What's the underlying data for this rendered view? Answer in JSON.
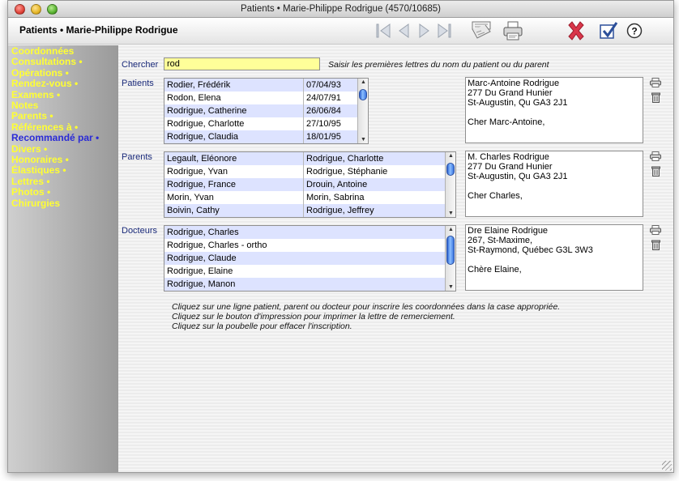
{
  "window": {
    "title": "Patients • Marie-Philippe Rodrigue (4570/10685)"
  },
  "header": {
    "title": "Patients • Marie-Philippe Rodrigue"
  },
  "toolbar": {
    "icons": [
      "first-record-icon",
      "previous-record-icon",
      "next-record-icon",
      "last-record-icon",
      "envelope-icon",
      "print-icon",
      "delete-icon",
      "validate-icon",
      "help-icon"
    ],
    "help_label": "?"
  },
  "sidebar": {
    "items": [
      {
        "label": "Coordonnées"
      },
      {
        "label": "Consultations •"
      },
      {
        "label": "Opérations •"
      },
      {
        "label": "Rendez-vous •"
      },
      {
        "label": "Examens •"
      },
      {
        "label": "Notes"
      },
      {
        "label": "Parents •"
      },
      {
        "label": "Références à •"
      },
      {
        "label": "Recommandé par •"
      },
      {
        "label": "Divers •"
      },
      {
        "label": "Honoraires •"
      },
      {
        "label": "Élastiques •"
      },
      {
        "label": "Lettres •"
      },
      {
        "label": "Photos •"
      },
      {
        "label": "Chirurgies"
      }
    ],
    "active_index": 8
  },
  "search": {
    "label": "Chercher",
    "value": "rod",
    "hint": "Saisir les premières lettres du nom du patient ou du parent"
  },
  "patients": {
    "label": "Patients",
    "rows": [
      [
        "Rodier, Frédérik",
        "07/04/93"
      ],
      [
        "Rodon, Elena",
        "24/07/91"
      ],
      [
        "Rodrigue, Catherine",
        "26/06/84"
      ],
      [
        "Rodrigue, Charlotte",
        "27/10/95"
      ],
      [
        "Rodrigue, Claudia",
        "18/01/95"
      ]
    ],
    "letter": [
      "Marc-Antoine Rodrigue",
      "277 Du Grand Hunier",
      "St-Augustin, Qu  GA3 2J1",
      "",
      "Cher Marc-Antoine,"
    ]
  },
  "parents": {
    "label": "Parents",
    "rows": [
      [
        "Legault, Eléonore",
        "Rodrigue, Charlotte"
      ],
      [
        "Rodrigue, Yvan",
        "Rodrigue, Stéphanie"
      ],
      [
        "Rodrigue, France",
        "Drouin, Antoine"
      ],
      [
        "Morin, Yvan",
        "Morin, Sabrina"
      ],
      [
        "Boivin, Cathy",
        "Rodrigue, Jeffrey"
      ]
    ],
    "letter": [
      "M. Charles Rodrigue",
      "277 Du Grand Hunier",
      "St-Augustin, Qu  GA3 2J1",
      "",
      "Cher Charles,"
    ]
  },
  "doctors": {
    "label": "Docteurs",
    "rows": [
      [
        "Rodrigue, Charles"
      ],
      [
        "Rodrigue, Charles - ortho"
      ],
      [
        "Rodrigue, Claude"
      ],
      [
        "Rodrigue, Elaine"
      ],
      [
        "Rodrigue, Manon"
      ]
    ],
    "letter": [
      "Dre Elaine Rodrigue",
      "267, St-Maxime,",
      "St-Raymond, Québec  G3L 3W3",
      "",
      "Chère Elaine,"
    ]
  },
  "instructions": [
    "Cliquez sur une ligne patient, parent ou docteur pour inscrire les coordonnées dans la case appropriée.",
    "Cliquez sur le bouton d'impression pour imprimer la lettre de remerciement.",
    "Cliquez sur la poubelle pour effacer l'inscription."
  ]
}
